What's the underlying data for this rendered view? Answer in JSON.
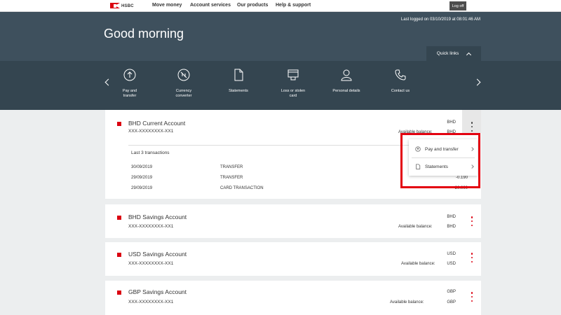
{
  "brand": {
    "logo_text": "HSBC",
    "accent": "#db0011"
  },
  "nav": {
    "items": [
      "Move money",
      "Account services",
      "Our products",
      "Help & support"
    ],
    "logoff": "Log off"
  },
  "hero": {
    "last_logged": "Last logged on 03/10/2019 at 08:01:46 AM",
    "greeting": "Good morning",
    "quick_links": "Quick links"
  },
  "quick_links": [
    {
      "label": "Pay and\ntransfer",
      "icon": "arrow-up-circle-icon"
    },
    {
      "label": "Currency\nconverter",
      "icon": "currency-icon"
    },
    {
      "label": "Statements",
      "icon": "document-icon"
    },
    {
      "label": "Loss or stolen\ncard",
      "icon": "card-icon"
    },
    {
      "label": "Personal details",
      "icon": "person-icon"
    },
    {
      "label": "Contact us",
      "icon": "phone-icon"
    }
  ],
  "accounts": [
    {
      "name": "BHD Current Account",
      "number": "XXX-XXXXXXXX-XX1",
      "currency": "BHD",
      "balance_label": "Available balance:",
      "balance_currency": "BHD",
      "transactions_title": "Last 3 transactions",
      "transactions": [
        {
          "date": "30/09/2019",
          "type": "TRANSFER",
          "amount": ""
        },
        {
          "date": "29/09/2019",
          "type": "TRANSFER",
          "amount": "-0.190"
        },
        {
          "date": "29/09/2019",
          "type": "CARD TRANSACTION",
          "amount": "-20.000"
        }
      ]
    },
    {
      "name": "BHD Savings Account",
      "number": "XXX-XXXXXXXX-XX1",
      "currency": "BHD",
      "balance_label": "Available balance:",
      "balance_currency": "BHD"
    },
    {
      "name": "USD Savings Account",
      "number": "XXX-XXXXXXXX-XX1",
      "currency": "USD",
      "balance_label": "Available balance:",
      "balance_currency": "USD"
    },
    {
      "name": "GBP Savings Account",
      "number": "XXX-XXXXXXXX-XX1",
      "currency": "GBP",
      "balance_label": "Available balance:",
      "balance_currency": "GBP"
    }
  ],
  "dropdown": {
    "items": [
      {
        "label": "Pay and transfer",
        "icon": "pay-transfer-icon"
      },
      {
        "label": "Statements",
        "icon": "statements-icon"
      }
    ],
    "highlight_color": "#e3000f"
  }
}
